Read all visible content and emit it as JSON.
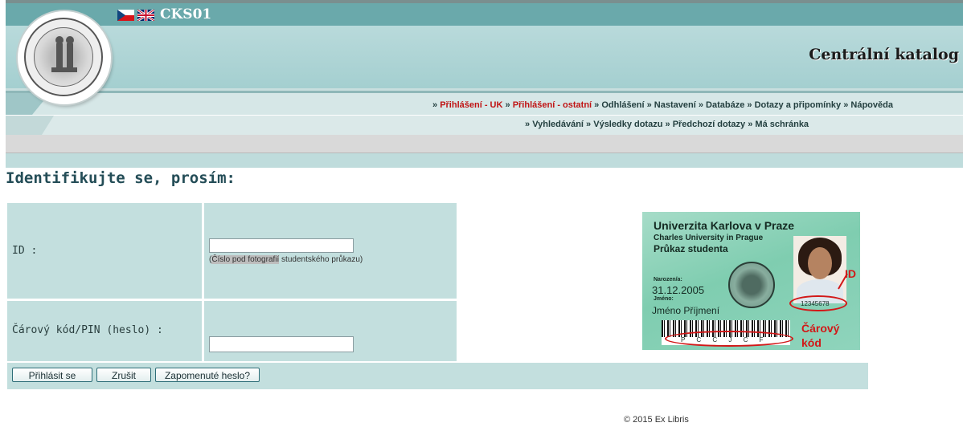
{
  "header": {
    "app_code": "CKS01",
    "catalog_title": "Centrální katalog",
    "languages": [
      "cz-flag-icon",
      "uk-flag-icon"
    ]
  },
  "nav": {
    "row1": [
      {
        "label": "Přihlášení - UK",
        "red": true
      },
      {
        "label": "Přihlášení - ostatní",
        "red": true
      },
      {
        "label": "Odhlášení",
        "red": false
      },
      {
        "label": "Nastavení",
        "red": false
      },
      {
        "label": "Databáze",
        "red": false
      },
      {
        "label": "Dotazy a připomínky",
        "red": false
      },
      {
        "label": "Nápověda",
        "red": false
      }
    ],
    "row2": [
      {
        "label": "Vyhledávání"
      },
      {
        "label": "Výsledky dotazu"
      },
      {
        "label": "Předchozí dotazy"
      },
      {
        "label": "Má schránka"
      }
    ],
    "separator": "»"
  },
  "page": {
    "heading": "Identifikujte se, prosím:"
  },
  "form": {
    "id_label": "ID :",
    "id_value": "",
    "id_hint_open": "(",
    "id_hint_highlight": "Číslo pod fotografií",
    "id_hint_rest": " studentského průkazu)",
    "pin_label": "Čárový kód/PIN (heslo) :",
    "pin_value": ""
  },
  "buttons": {
    "login": "Přihlásit se",
    "cancel": "Zrušit",
    "forgot": "Zapomenuté heslo?"
  },
  "card": {
    "university_cz": "Univerzita Karlova v Praze",
    "university_en": "Charles University in Prague",
    "card_type": "Průkaz studenta",
    "born_label": "Narozen/a:",
    "born_value": "31.12.2005",
    "name_label": "Jméno:",
    "name_value": "Jméno Příjmení",
    "id_number": "12345678",
    "barcode_text": "P C C J C F",
    "annotation_id": "ID",
    "annotation_barcode_line1": "Čárový",
    "annotation_barcode_line2": "kód"
  },
  "footer": {
    "copyright": "© 2015 Ex Libris"
  },
  "colors": {
    "header_teal": "#6aa9ab",
    "panel": "#c3dfde",
    "nav_red": "#c01414",
    "heading": "#244d57"
  }
}
